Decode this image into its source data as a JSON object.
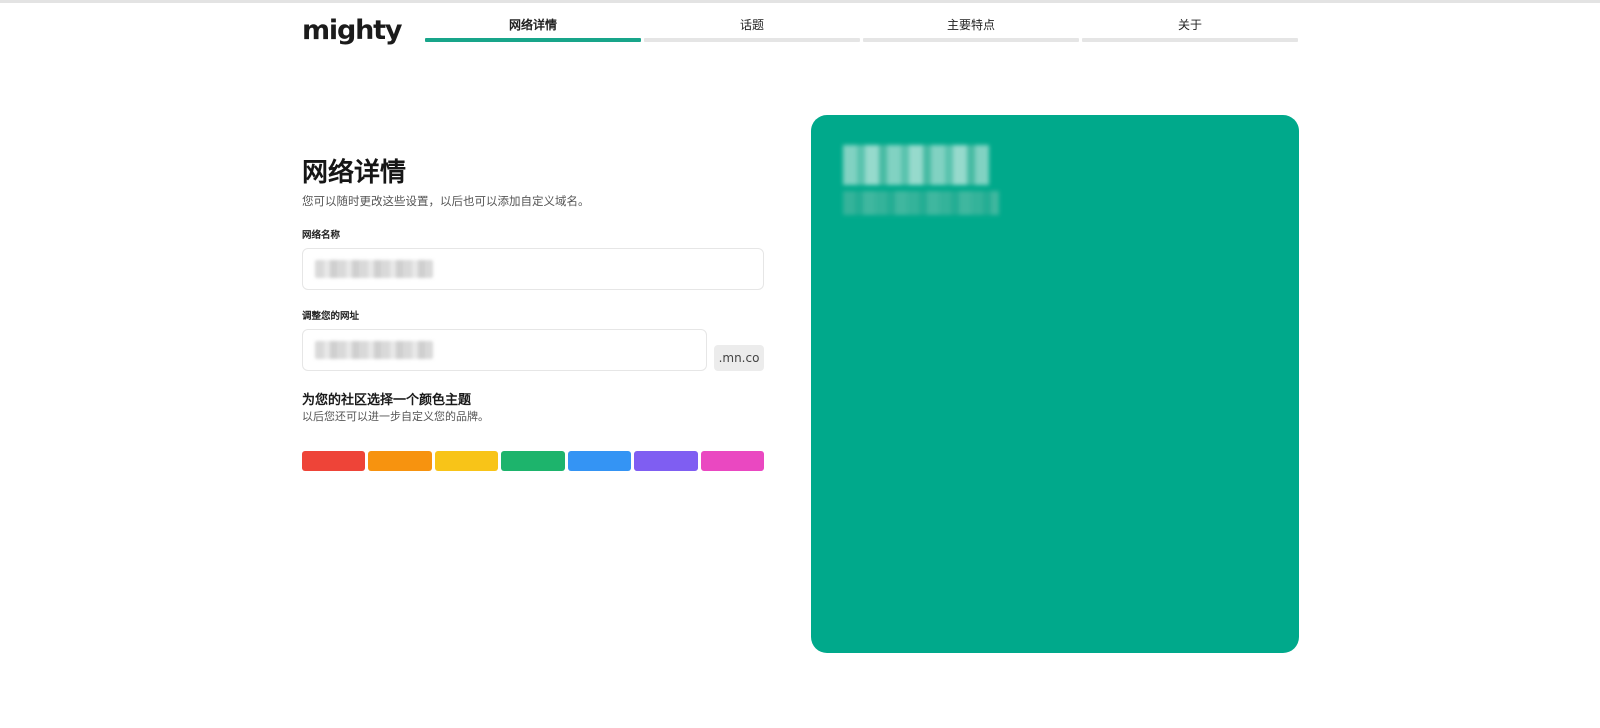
{
  "header": {
    "logo": "mighty",
    "steps": [
      {
        "label": "网络详情",
        "active": true
      },
      {
        "label": "话题",
        "active": false
      },
      {
        "label": "主要特点",
        "active": false
      },
      {
        "label": "关于",
        "active": false
      }
    ]
  },
  "form": {
    "title": "网络详情",
    "subtitle": "您可以随时更改这些设置，以后也可以添加自定义域名。",
    "network_name_label": "网络名称",
    "network_name_value": "",
    "url_label": "调整您的网址",
    "url_value": "",
    "url_suffix": ".mn.co",
    "theme_title": "为您的社区选择一个颜色主题",
    "theme_subtitle": "以后您还可以进一步自定义您的品牌。"
  },
  "colors": {
    "accent": "#18a58a",
    "preview_background": "#00a98b",
    "swatches": [
      "#ee4438",
      "#f7930f",
      "#f8c418",
      "#1db46c",
      "#3494f4",
      "#7f5ef2",
      "#ea48c1"
    ]
  }
}
